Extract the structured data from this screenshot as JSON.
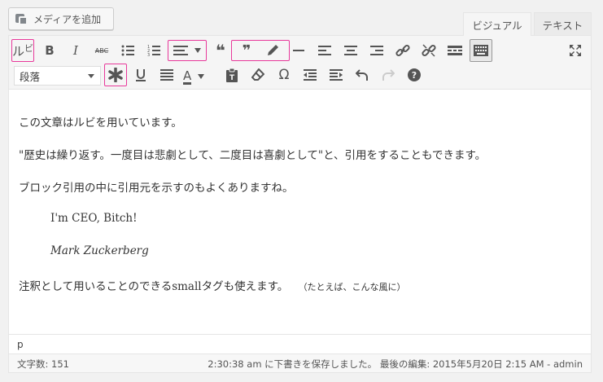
{
  "media_button": {
    "label": "メディアを追加",
    "icon": "media-icon"
  },
  "tabs": [
    {
      "label": "ビジュアル",
      "active": true
    },
    {
      "label": "テキスト",
      "active": false
    }
  ],
  "toolbar": {
    "ruby_label": "ル",
    "ruby_small": "ビ",
    "bold_label": "B",
    "italic_label": "I",
    "strike_label": "ABC",
    "format_select": "段落",
    "text_color_label": "A",
    "omega_label": "Ω",
    "help_label": "?",
    "highlight_color": "#e8399b"
  },
  "content": {
    "p1": "この文章はルビを用いています。",
    "p2": "\"歴史は繰り返す。一度目は悲劇として、二度目は喜劇として\"と、引用をすることもできます。",
    "p3": "ブロック引用の中に引用元を示すのもよくありますね。",
    "quote": "I'm CEO, Bitch!",
    "cite": "Mark Zuckerberg",
    "p4": "注釈として用いることのできるsmallタグも使えます。",
    "p4_small": "（たとえば、こんな風に）"
  },
  "path": "p",
  "status": {
    "word_count": "文字数: 151",
    "saved": "2:30:38 am に下書きを保存しました。 最後の編集: 2015年5月20日 2:15 AM - admin"
  }
}
